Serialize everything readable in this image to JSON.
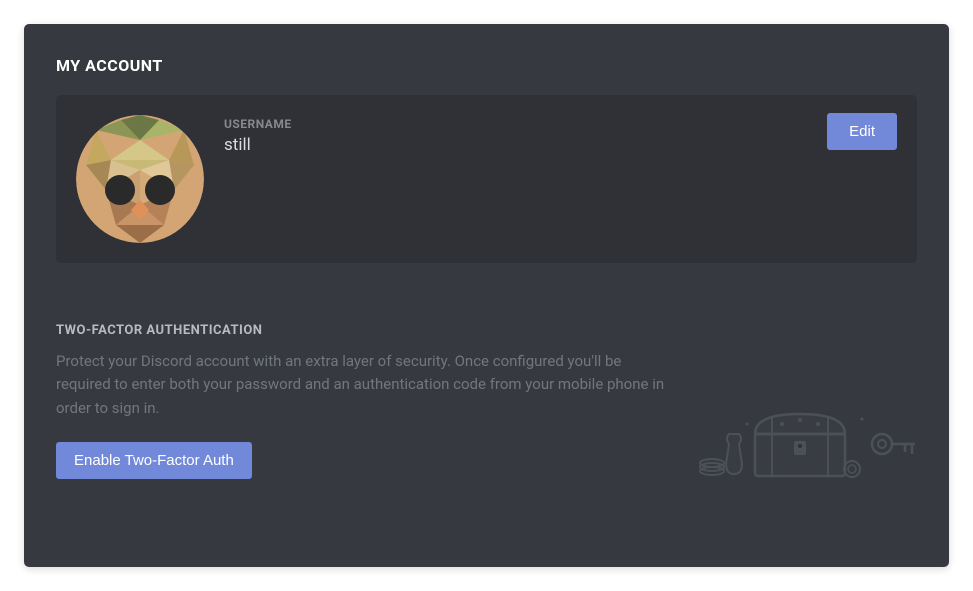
{
  "header": {
    "title": "MY ACCOUNT"
  },
  "account": {
    "username_label": "USERNAME",
    "username_value": "still",
    "edit_label": "Edit"
  },
  "twofa": {
    "title": "TWO-FACTOR AUTHENTICATION",
    "description": "Protect your Discord account with an extra layer of security. Once configured you'll be required to enter both your password and an authentication code from your mobile phone in order to sign in.",
    "enable_label": "Enable Two-Factor Auth"
  },
  "colors": {
    "accent": "#7289da",
    "panel_bg": "#36393f",
    "card_bg": "#2f3136"
  }
}
